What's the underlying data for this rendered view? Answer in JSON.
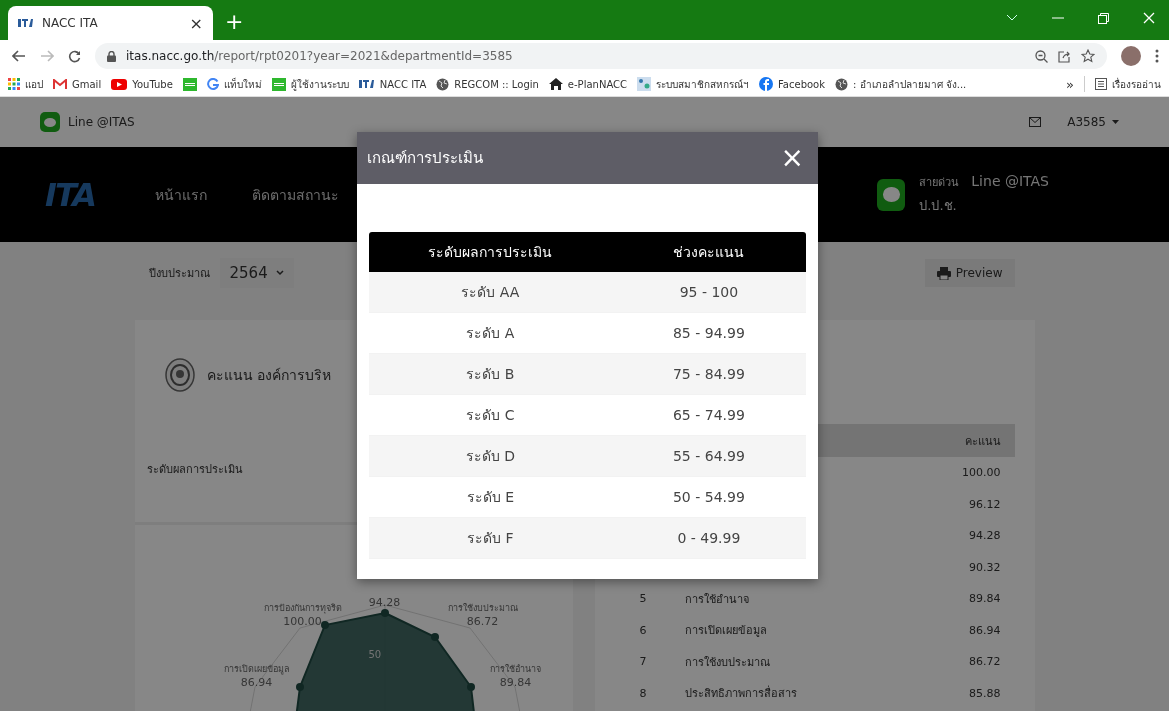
{
  "browser": {
    "tab_title": "NACC ITA",
    "tab_close": "×",
    "new_tab": "+",
    "url_host": "itas.nacc.go.th",
    "url_path": "/report/rpt0201?year=2021&departmentId=3585",
    "bookmarks": [
      {
        "label": "แอป"
      },
      {
        "label": "Gmail"
      },
      {
        "label": "YouTube"
      },
      {
        "label": "แท็บใหม่"
      },
      {
        "label": "ผู้ใช้งานระบบ"
      },
      {
        "label": "NACC ITA"
      },
      {
        "label": "REGCOM :: Login"
      },
      {
        "label": "e-PlanNACC"
      },
      {
        "label": "ระบบสมาชิกสหกรณ์ฯ"
      },
      {
        "label": "Facebook"
      },
      {
        "label": ": อำเภอลำปลายมาศ จัง..."
      }
    ],
    "more": "»",
    "reading_list": "เรื่องรออ่าน"
  },
  "topbar": {
    "line_label": "Line @ITAS",
    "user": "A3585"
  },
  "nav": {
    "logo": "ITA",
    "items": [
      "หน้าแรก",
      "ติดตามสถานะ"
    ],
    "hotline_label": "สายด่วน",
    "hotline_name": "Line @ITAS",
    "hotline_org": "ป.ป.ช."
  },
  "filter": {
    "label": "ปีงบประมาณ",
    "year": "2564",
    "preview": "Preview"
  },
  "left_card": {
    "title": "คะแนน องค์การบริห",
    "level_label": "ระดับผลการประเมิน",
    "radar_labels": [
      {
        "name": "การป้องกันการทุจริต",
        "value": "100.00"
      },
      {
        "value": "94.28"
      },
      {
        "name": "การใช้งบประมาณ",
        "value": "86.72"
      },
      {
        "name": "การเปิดเผยข้อมูล",
        "value": "86.94"
      },
      {
        "name": "การใช้อำนาจ",
        "value": "89.84"
      }
    ],
    "radar_tick": "50"
  },
  "right_card": {
    "score_header": "คะแนน",
    "rows": [
      {
        "score": "100.00"
      },
      {
        "score": "96.12"
      },
      {
        "score": "94.28"
      },
      {
        "score": "90.32"
      },
      {
        "no": "5",
        "name": "การใช้อำนาจ",
        "score": "89.84"
      },
      {
        "no": "6",
        "name": "การเปิดเผยข้อมูล",
        "score": "86.94"
      },
      {
        "no": "7",
        "name": "การใช้งบประมาณ",
        "score": "86.72"
      },
      {
        "no": "8",
        "name": "ประสิทธิภาพการสื่อสาร",
        "score": "85.88"
      }
    ]
  },
  "modal": {
    "title": "เกณฑ์การประเมิน",
    "close": "×",
    "columns": [
      "ระดับผลการประเมิน",
      "ช่วงคะแนน"
    ],
    "rows": [
      [
        "ระดับ AA",
        "95 - 100"
      ],
      [
        "ระดับ A",
        "85 - 94.99"
      ],
      [
        "ระดับ B",
        "75 - 84.99"
      ],
      [
        "ระดับ C",
        "65 - 74.99"
      ],
      [
        "ระดับ D",
        "55 - 64.99"
      ],
      [
        "ระดับ E",
        "50 - 54.99"
      ],
      [
        "ระดับ F",
        "0 - 49.99"
      ]
    ]
  }
}
